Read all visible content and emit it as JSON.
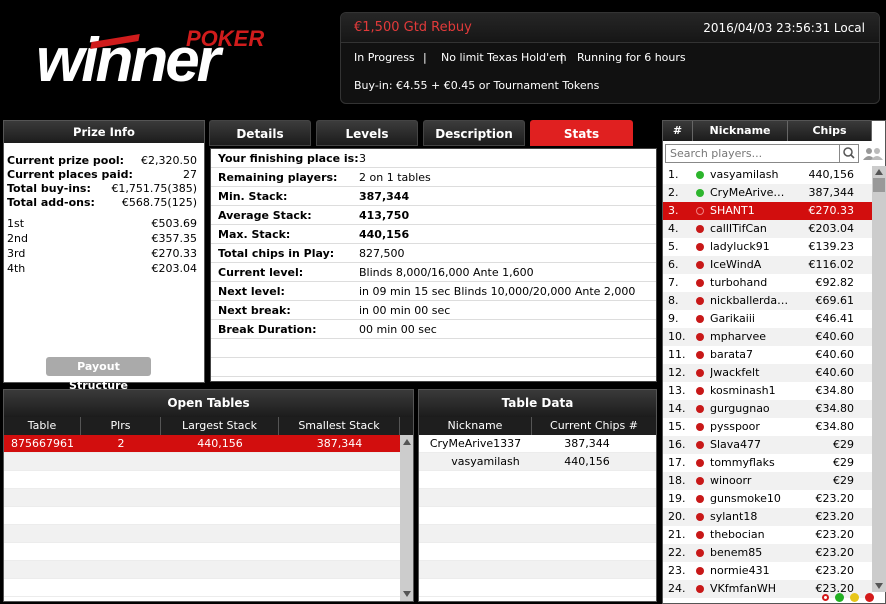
{
  "brand": {
    "logo_poker": "POKER",
    "logo_winner": "winner"
  },
  "tournament": {
    "title": "€1,500 Gtd Rebuy",
    "datetime": "2016/04/03 23:56:31 Local",
    "status": "In Progress",
    "sep1": "|",
    "game": "No limit Texas Hold'em",
    "sep2": "|",
    "running": "Running for 6 hours",
    "buyin": "Buy-in: €4.55 + €0.45 or Tournament Tokens"
  },
  "prize_info": {
    "title": "Prize Info",
    "rows": [
      {
        "label": "Current prize pool:",
        "value": "€2,320.50"
      },
      {
        "label": "Current places paid:",
        "value": "27"
      },
      {
        "label": "Total buy-ins:",
        "value": "€1,751.75(385)"
      },
      {
        "label": "Total add-ons:",
        "value": "€568.75(125)"
      }
    ],
    "places": [
      {
        "label": "1st",
        "value": "€503.69"
      },
      {
        "label": "2nd",
        "value": "€357.35"
      },
      {
        "label": "3rd",
        "value": "€270.33"
      },
      {
        "label": "4th",
        "value": "€203.04"
      }
    ],
    "payout_button": "Payout Structure"
  },
  "tabs": [
    "Details",
    "Levels",
    "Description",
    "Stats"
  ],
  "active_tab": "Stats",
  "stats": [
    {
      "label": "Your finishing place is:",
      "value": "3",
      "bold": false
    },
    {
      "label": "Remaining players:",
      "value": "2 on 1 tables",
      "bold": false
    },
    {
      "label": "Min. Stack:",
      "value": "387,344",
      "bold": true
    },
    {
      "label": "Average Stack:",
      "value": "413,750",
      "bold": true
    },
    {
      "label": "Max. Stack:",
      "value": "440,156",
      "bold": true
    },
    {
      "label": "Total chips in Play:",
      "value": "827,500",
      "bold": false
    },
    {
      "label": "Current level:",
      "value": "Blinds 8,000/16,000 Ante 1,600",
      "bold": false
    },
    {
      "label": "Next level:",
      "value": "in 09 min 15 sec  Blinds 10,000/20,000 Ante 2,000",
      "bold": false
    },
    {
      "label": "Next break:",
      "value": "in 00 min 00 sec",
      "bold": false
    },
    {
      "label": "Break Duration:",
      "value": "00 min 00 sec",
      "bold": false
    }
  ],
  "open_tables": {
    "title": "Open Tables",
    "columns": [
      "Table",
      "Plrs",
      "Largest Stack",
      "Smallest Stack"
    ],
    "rows": [
      {
        "table": "875667961",
        "plrs": "2",
        "largest": "440,156",
        "smallest": "387,344"
      }
    ]
  },
  "table_data": {
    "title": "Table Data",
    "columns": [
      "Nickname",
      "Current Chips #"
    ],
    "rows": [
      {
        "nickname": "CryMeArive1337",
        "chips": "387,344"
      },
      {
        "nickname": "vasyamilash",
        "chips": "440,156"
      }
    ]
  },
  "players": {
    "columns": [
      "#",
      "Nickname",
      "Chips"
    ],
    "search_placeholder": "Search players...",
    "colors": {
      "active": "#2db52d",
      "out": "#c81818"
    },
    "rows": [
      {
        "rank": "1.",
        "name": "vasyamilash",
        "chips": "440,156",
        "status": "active"
      },
      {
        "rank": "2.",
        "name": "CryMeArive1337",
        "chips": "387,344",
        "status": "active"
      },
      {
        "rank": "3.",
        "name": "SHANT1",
        "chips": "€270.33",
        "status": "selected"
      },
      {
        "rank": "4.",
        "name": "callITifCan",
        "chips": "€203.04",
        "status": "out"
      },
      {
        "rank": "5.",
        "name": "ladyluck91",
        "chips": "€139.23",
        "status": "out"
      },
      {
        "rank": "6.",
        "name": "IceWindA",
        "chips": "€116.02",
        "status": "out"
      },
      {
        "rank": "7.",
        "name": "turbohand",
        "chips": "€92.82",
        "status": "out"
      },
      {
        "rank": "8.",
        "name": "nickballerdawg",
        "chips": "€69.61",
        "status": "out"
      },
      {
        "rank": "9.",
        "name": "Garikaiii",
        "chips": "€46.41",
        "status": "out"
      },
      {
        "rank": "10.",
        "name": "mpharvee",
        "chips": "€40.60",
        "status": "out"
      },
      {
        "rank": "11.",
        "name": "barata7",
        "chips": "€40.60",
        "status": "out"
      },
      {
        "rank": "12.",
        "name": "Jwackfelt",
        "chips": "€40.60",
        "status": "out"
      },
      {
        "rank": "13.",
        "name": "kosminash1",
        "chips": "€34.80",
        "status": "out"
      },
      {
        "rank": "14.",
        "name": "gurgugnao",
        "chips": "€34.80",
        "status": "out"
      },
      {
        "rank": "15.",
        "name": "pysspoor",
        "chips": "€34.80",
        "status": "out"
      },
      {
        "rank": "16.",
        "name": "Slava477",
        "chips": "€29",
        "status": "out"
      },
      {
        "rank": "17.",
        "name": "tommyflaks",
        "chips": "€29",
        "status": "out"
      },
      {
        "rank": "18.",
        "name": "winoorr",
        "chips": "€29",
        "status": "out"
      },
      {
        "rank": "19.",
        "name": "gunsmoke10",
        "chips": "€23.20",
        "status": "out"
      },
      {
        "rank": "20.",
        "name": "sylant18",
        "chips": "€23.20",
        "status": "out"
      },
      {
        "rank": "21.",
        "name": "thebocian",
        "chips": "€23.20",
        "status": "out"
      },
      {
        "rank": "22.",
        "name": "benem85",
        "chips": "€23.20",
        "status": "out"
      },
      {
        "rank": "23.",
        "name": "normie431",
        "chips": "€23.20",
        "status": "out"
      },
      {
        "rank": "24.",
        "name": "VKfmfanWH",
        "chips": "€23.20",
        "status": "out"
      }
    ],
    "indicators": [
      "red",
      "green",
      "yellow",
      "red"
    ]
  }
}
